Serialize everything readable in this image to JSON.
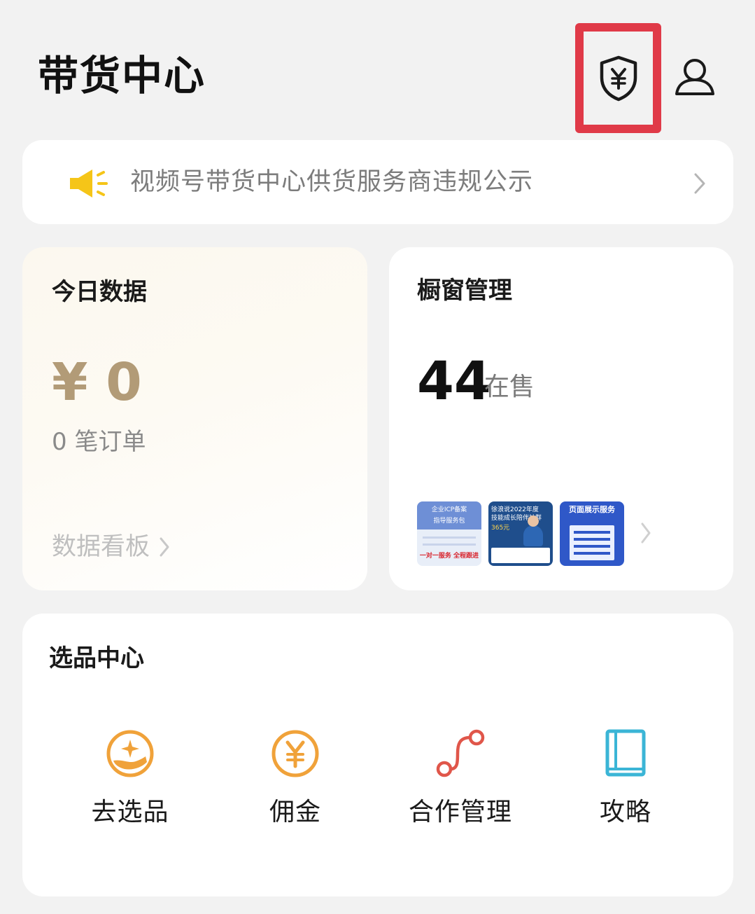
{
  "header": {
    "title": "带货中心",
    "shield_icon": "shield-yen-icon",
    "user_icon": "user-icon",
    "highlight_color": "#e03a48"
  },
  "notice": {
    "icon": "megaphone-icon",
    "text": "视频号带货中心供货服务商违规公示",
    "icon_color": "#f5c518"
  },
  "today_data": {
    "title": "今日数据",
    "amount": "¥ 0",
    "orders": "0 笔订单",
    "dashboard_link": "数据看板",
    "amount_color": "#b29b77"
  },
  "window_management": {
    "title": "橱窗管理",
    "on_sale_count": "44",
    "on_sale_label": "在售",
    "thumbnails": [
      {
        "lines": [
          "企业ICP备案",
          "指导服务包",
          "一对一服务 全程跟进"
        ]
      },
      {
        "lines": [
          "徐浪说2022年度",
          "技能成长陪伴社群",
          "365元"
        ]
      },
      {
        "lines": [
          "页面展示服务"
        ]
      }
    ]
  },
  "select_center": {
    "title": "选品中心",
    "tools": [
      {
        "label": "去选品",
        "icon": "hand-star-icon",
        "color": "#f0a23a"
      },
      {
        "label": "佣金",
        "icon": "yen-circle-icon",
        "color": "#f0a23a"
      },
      {
        "label": "合作管理",
        "icon": "path-nodes-icon",
        "color": "#e0564a"
      },
      {
        "label": "攻略",
        "icon": "book-icon",
        "color": "#3bb5d6"
      }
    ]
  }
}
